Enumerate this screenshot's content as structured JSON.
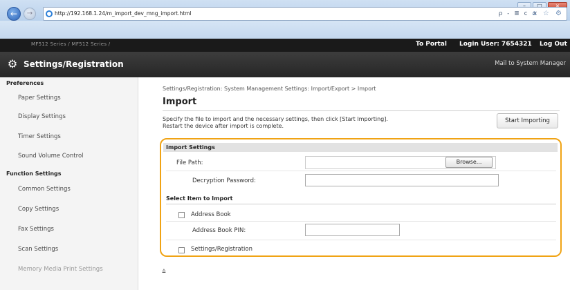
{
  "browser": {
    "back_icon": "arrow-left-icon",
    "url": "http://192.168.1.24/m_import_dev_mng_import.html",
    "address_tools": "ρ - ≣ c ×",
    "address_tools2": "⌂ ☆ ⚙"
  },
  "header": {
    "system_name": "MF512 Series / MF512 Series /",
    "to_portal": "To Portal",
    "login_user": "Login User: 7654321",
    "logout": "Log Out",
    "app_title": "Settings/Registration",
    "mail_link": "Mail to System Manager"
  },
  "sidebar": {
    "sections": [
      {
        "heading": "Preferences",
        "items": [
          "Paper Settings",
          "Display Settings",
          "Timer Settings",
          "Sound Volume Control"
        ]
      },
      {
        "heading": "Function Settings",
        "items": [
          "Common Settings",
          "Copy Settings",
          "Fax Settings",
          "Scan Settings",
          "Memory Media Print Settings"
        ]
      }
    ]
  },
  "main": {
    "breadcrumb": "Settings/Registration: System Management Settings: Import/Export > Import",
    "title": "Import",
    "desc_line1": "Specify the file to import and the necessary settings, then click [Start Importing].",
    "desc_line2": "Restart the device after import is complete.",
    "start_button": "Start Importing",
    "import_settings": {
      "heading": "Import Settings",
      "file_path_label": "File Path:",
      "browse_label": "Browse...",
      "decryption_label": "Decryption Password:",
      "select_heading": "Select Item to Import",
      "address_book_label": "Address Book",
      "address_book_pin_label": "Address Book PIN:",
      "settings_label": "Settings/Registration"
    },
    "to_top": "⩮"
  },
  "colors": {
    "highlight": "#f0a314",
    "header_dark": "#262626"
  }
}
